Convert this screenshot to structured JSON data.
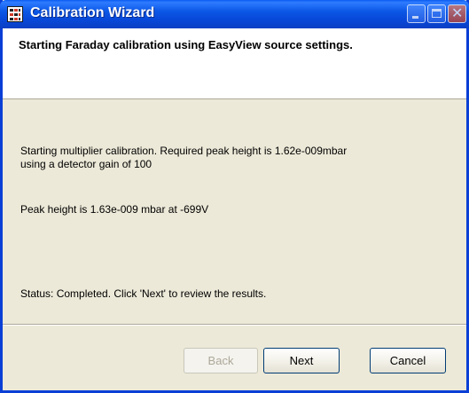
{
  "window": {
    "title": "Calibration Wizard",
    "title_icon": "calibration-wizard-icon",
    "controls": {
      "minimize": "minimize-icon",
      "maximize": "maximize-icon",
      "close": "close-icon"
    }
  },
  "header": {
    "text": "Starting Faraday calibration using EasyView source settings."
  },
  "body": {
    "line1a": "Starting multiplier calibration.  Required peak height is 1.62e-009mbar",
    "line1b": "using a detector gain of 100",
    "line2": "Peak height is 1.63e-009 mbar at -699V",
    "status": "Status: Completed.  Click 'Next' to review the results."
  },
  "buttons": {
    "back": "Back",
    "next": "Next",
    "cancel": "Cancel"
  },
  "colors": {
    "titlebar": "#0a54e3",
    "dialog_bg": "#ece9d8",
    "header_bg": "#ffffff",
    "disabled_text": "#aca899"
  }
}
